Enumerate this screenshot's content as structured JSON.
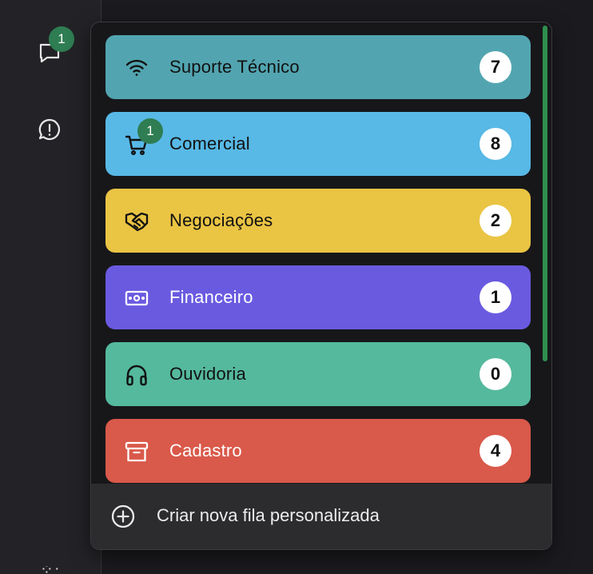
{
  "sidebar": {
    "chat_badge": "1",
    "icons": [
      "chat-bubble-icon",
      "alert-bubble-icon",
      "grid-icon"
    ]
  },
  "queues": [
    {
      "name": "Suporte Técnico",
      "count": "7",
      "icon": "wifi-icon",
      "color": "#52a5b0",
      "text_color": "#111111"
    },
    {
      "name": "Comercial",
      "count": "8",
      "icon": "cart-icon",
      "color": "#58b9e6",
      "text_color": "#111111",
      "badge": "1"
    },
    {
      "name": "Negociações",
      "count": "2",
      "icon": "handshake-icon",
      "color": "#eac443",
      "text_color": "#111111"
    },
    {
      "name": "Financeiro",
      "count": "1",
      "icon": "cash-icon",
      "color": "#6a5ae0",
      "text_color": "#ffffff"
    },
    {
      "name": "Ouvidoria",
      "count": "0",
      "icon": "headphones-icon",
      "color": "#55b99d",
      "text_color": "#111111"
    },
    {
      "name": "Cadastro",
      "count": "4",
      "icon": "archive-icon",
      "color": "#d9594a",
      "text_color": "#ffffff"
    }
  ],
  "create_queue": {
    "label": "Criar nova fila personalizada",
    "icon": "plus-circle-icon"
  },
  "colors": {
    "badge_green": "#2f7d52",
    "scrollbar": "#2f8f4e"
  }
}
